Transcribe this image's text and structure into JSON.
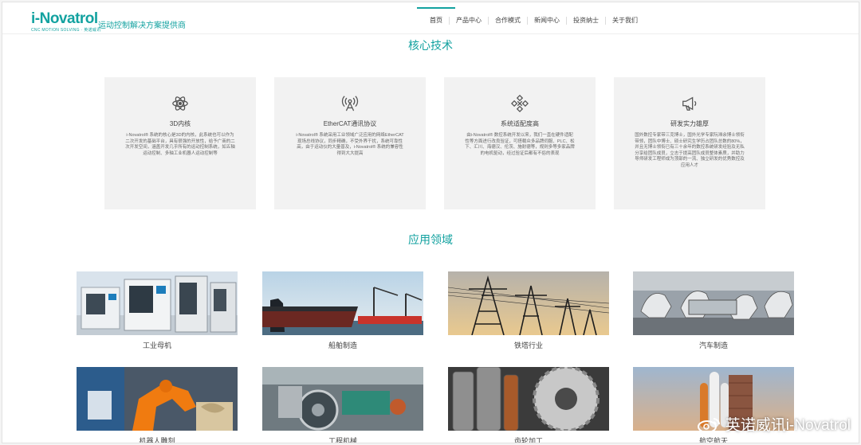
{
  "header": {
    "logo": "i-Novatrol",
    "logo_sub": "CNC MOTION SOLVING · 英诺威讯",
    "tagline": "运动控制解决方案提供商",
    "nav": [
      "首页",
      "产品中心",
      "合作模式",
      "新闻中心",
      "投资纳士",
      "关于我们"
    ]
  },
  "tech": {
    "title": "核心技术",
    "cards": [
      {
        "icon": "atom-icon",
        "title": "3D内核",
        "desc": "i-Novatrol® 系统的核心是3D的内核，此系统也可以作为二次开发的基础平台，具有很强的开放性，给予广商的二次开发空间，涵盖开发几乎所有的运动控制系统，如五轴运动控制、多轴工业机器人运动控制等"
      },
      {
        "icon": "antenna-icon",
        "title": "EtherCAT通讯协议",
        "desc": "i-Novatrol® 系统采用工业领域广泛应用的网络EtherCAT现场总线协议，同步精确，不受外界干扰，系统可靠性高，由于运动仪的大量普及，i-Novatrol® 系统的兼容性得到大大提高"
      },
      {
        "icon": "network-icon",
        "title": "系统适配度高",
        "desc": "由i-Novatrol® 数控系统开发以来，我们一直在硬件适配性等方面进行改良验证，可搭载众多品牌伺服、PLC、松下、汇川、海德汉、伦茨、施耐德等，规则多等多家品牌的电机驱动，经过验证后都有不俗的表现"
      },
      {
        "icon": "megaphone-icon",
        "title": "研发实力雄厚",
        "desc": "国外数控专家带三克博士，国外光学专家阮滞余博士领衔带领，团队中博士、硕士研究生学历占团队总数的80%，并且无博士领衔已有三十余年的数控系统研发经验及无私分享给团队成员，立志于提高团队成员整体素质，并助力导师研发工程师成为顶部的一流、独立研发的优秀数控及应用人才"
      }
    ]
  },
  "apps": {
    "title": "应用领域",
    "items": [
      {
        "label": "工业母机",
        "img": "cnc-machines-photo"
      },
      {
        "label": "船舶制造",
        "img": "ship-photo"
      },
      {
        "label": "铁塔行业",
        "img": "pylon-photo"
      },
      {
        "label": "汽车制造",
        "img": "car-factory-photo"
      },
      {
        "label": "机器人雕刻",
        "img": "robot-carving-photo"
      },
      {
        "label": "工程机械",
        "img": "machinery-photo"
      },
      {
        "label": "齿轮加工",
        "img": "gears-photo"
      },
      {
        "label": "航空航天",
        "img": "shuttle-photo"
      }
    ]
  },
  "watermark": "英诺威讯i-Novatrol"
}
